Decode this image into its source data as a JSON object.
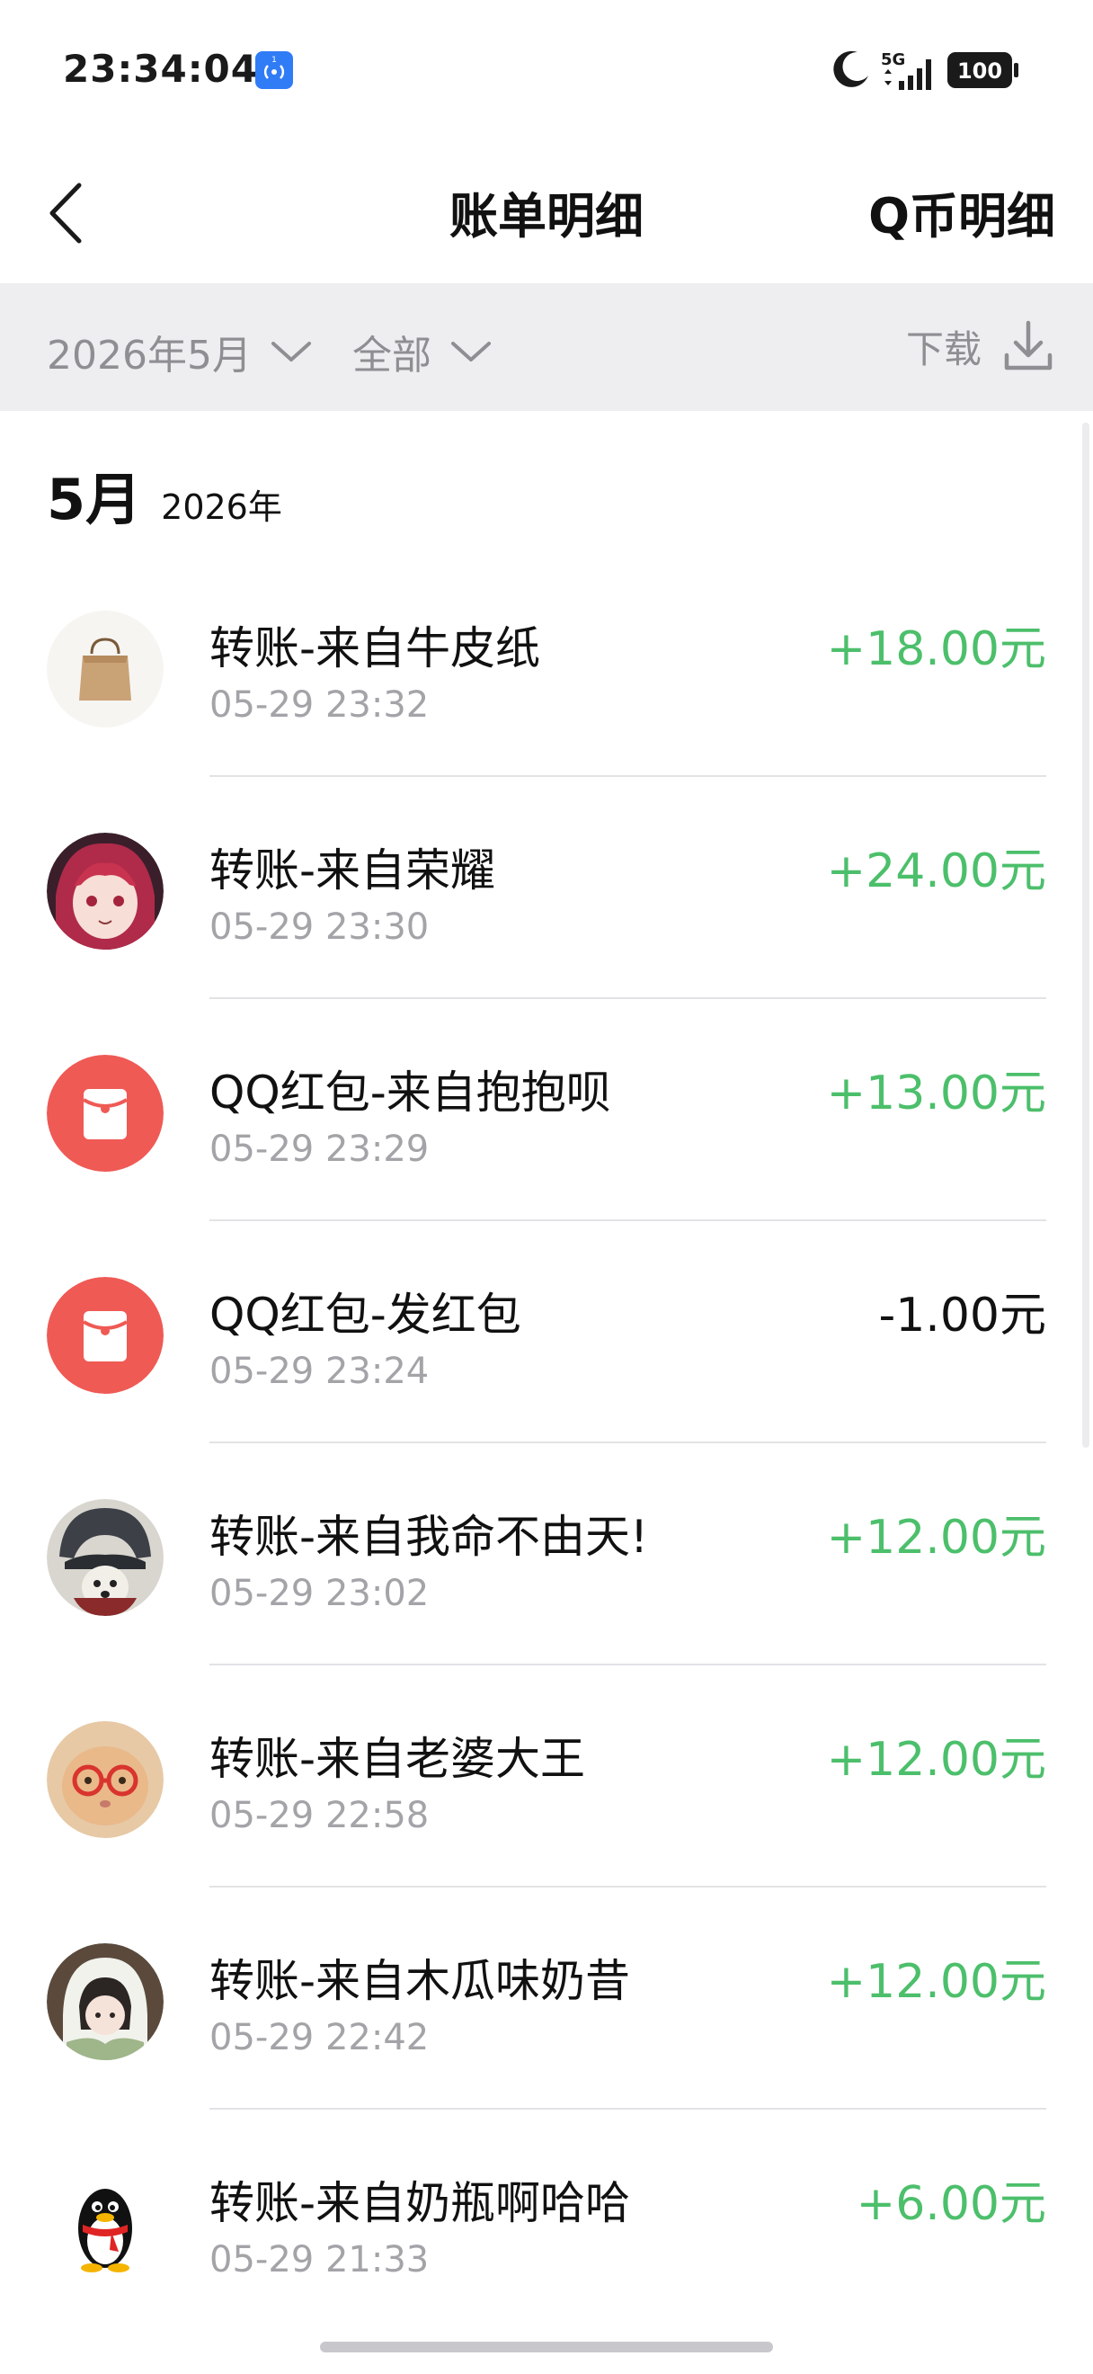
{
  "status_bar": {
    "time": "23:34:04",
    "network": "5G",
    "battery": "100"
  },
  "header": {
    "title": "账单明细",
    "right_link": "Q币明细"
  },
  "filter": {
    "month": "2026年5月",
    "type": "全部",
    "download_label": "下载"
  },
  "section": {
    "month": "5月",
    "year": "2026年"
  },
  "transactions": [
    {
      "title": "转账-来自牛皮纸",
      "time": "05-29 23:32",
      "amount": "+18.00元",
      "avatar": "shopping-bag-avatar"
    },
    {
      "title": "转账-来自荣耀",
      "time": "05-29 23:30",
      "amount": "+24.00元",
      "avatar": "anime-girl-avatar"
    },
    {
      "title": "QQ红包-来自抱抱呗",
      "time": "05-29 23:29",
      "amount": "+13.00元",
      "avatar": "red-packet-icon"
    },
    {
      "title": "QQ红包-发红包",
      "time": "05-29 23:24",
      "amount": "-1.00元",
      "avatar": "red-packet-icon"
    },
    {
      "title": "转账-来自我命不由天!",
      "time": "05-29 23:02",
      "amount": "+12.00元",
      "avatar": "dog-hat-avatar"
    },
    {
      "title": "转账-来自老婆大王",
      "time": "05-29 22:58",
      "amount": "+12.00元",
      "avatar": "cat-glasses-avatar"
    },
    {
      "title": "转账-来自木瓜味奶昔",
      "time": "05-29 22:42",
      "amount": "+12.00元",
      "avatar": "girl-hood-avatar"
    },
    {
      "title": "转账-来自奶瓶啊哈哈",
      "time": "05-29 21:33",
      "amount": "+6.00元",
      "avatar": "qq-penguin-avatar"
    }
  ],
  "colors": {
    "income": "#4cbf6b",
    "expense": "#111111",
    "red_packet": "#ef5a55",
    "filter_bg": "#eeeef0"
  }
}
